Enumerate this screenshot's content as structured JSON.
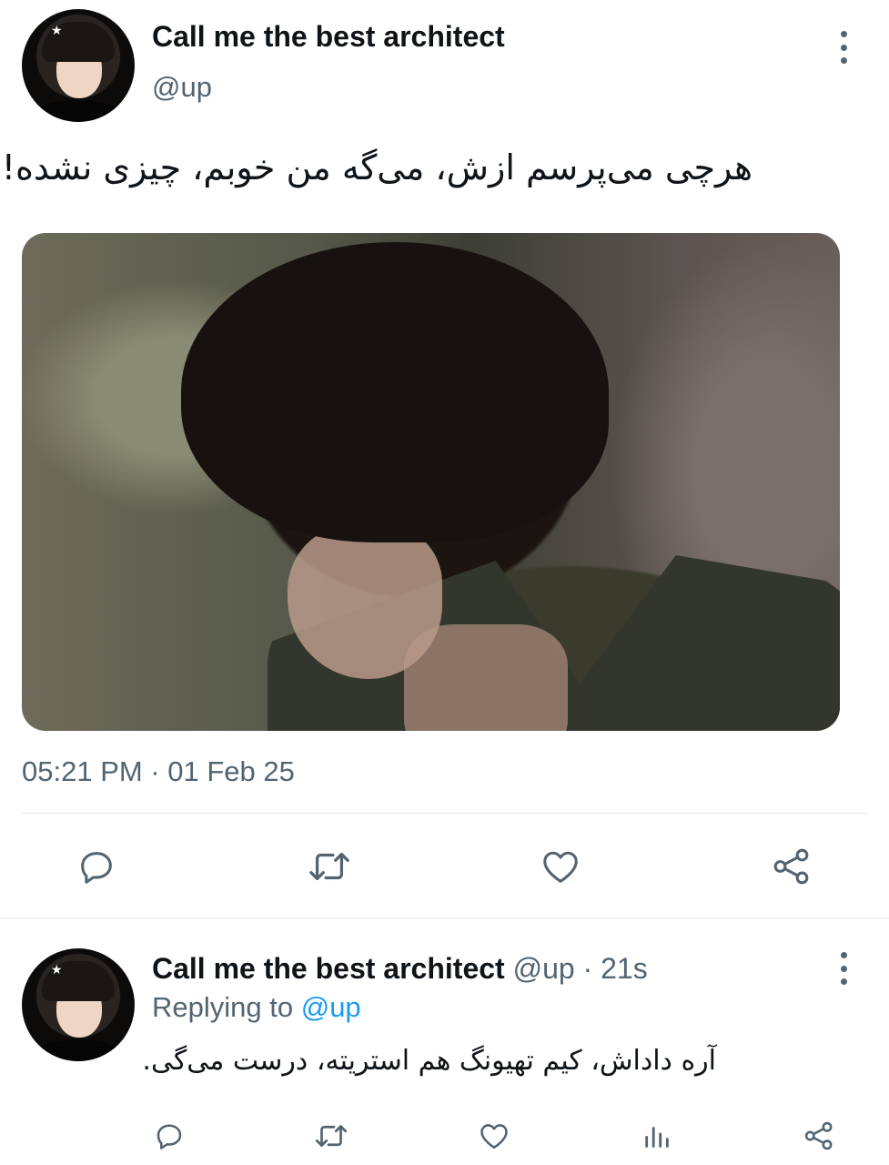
{
  "main_tweet": {
    "author_name": "Call me the best architect",
    "author_handle": "@up",
    "text": "هرچی می‌پرسم ازش، می‌گه من خوبم، چیزی نشده!",
    "timestamp": "05:21 PM · 01 Feb 25",
    "actions": [
      "reply-icon",
      "retweet-icon",
      "like-icon",
      "share-icon"
    ]
  },
  "reply_tweet": {
    "author_name": "Call me the best architect",
    "author_handle": "@up",
    "separator": " · ",
    "time_ago": "21s",
    "replying_prefix": "Replying to ",
    "replying_to": "@up",
    "text": "آره داداش، کیم تهیونگ هم استریته، درست می‌گی.",
    "actions": [
      "reply-icon",
      "retweet-icon",
      "like-icon",
      "views-icon",
      "share-icon"
    ]
  },
  "colors": {
    "text_primary": "#0f1419",
    "text_secondary": "#536471",
    "accent": "#1d9bf0",
    "divider": "#e1e8ed"
  }
}
